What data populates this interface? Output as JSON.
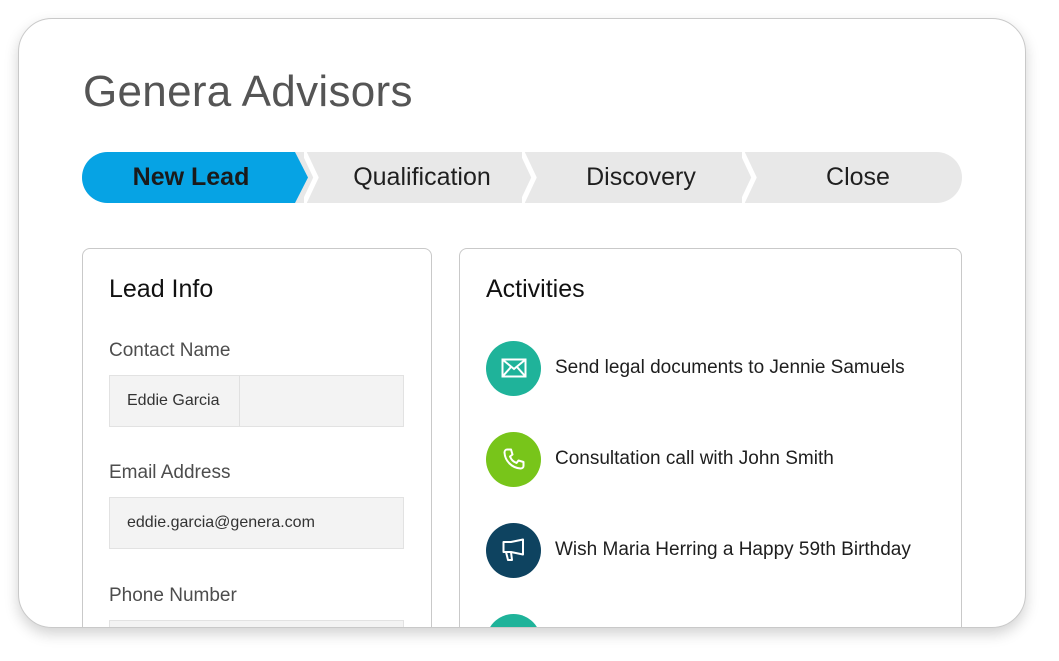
{
  "app": {
    "title": "Genera Advisors"
  },
  "stages": [
    {
      "label": "New Lead",
      "active": true
    },
    {
      "label": "Qualification",
      "active": false
    },
    {
      "label": "Discovery",
      "active": false
    },
    {
      "label": "Close",
      "active": false
    }
  ],
  "lead_info": {
    "title": "Lead Info",
    "fields": [
      {
        "label": "Contact Name",
        "value": "Eddie Garcia"
      },
      {
        "label": "Email Address",
        "value": "eddie.garcia@genera.com"
      },
      {
        "label": "Phone Number",
        "value": ""
      }
    ]
  },
  "activities": {
    "title": "Activities",
    "items": [
      {
        "text": "Send legal documents to Jennie Samuels",
        "icon": "mail-icon",
        "color": "#1fb39a"
      },
      {
        "text": "Consultation call with John Smith",
        "icon": "phone-icon",
        "color": "#78c51a"
      },
      {
        "text": "Wish Maria Herring a Happy 59th Birthday",
        "icon": "megaphone-icon",
        "color": "#0e4360"
      },
      {
        "text": "",
        "icon": "task-icon",
        "color": "#1fb39a"
      }
    ]
  },
  "colors": {
    "accent": "#06a3e4",
    "stage_bg": "#e8e8e8",
    "field_bg": "#f3f3f3"
  }
}
